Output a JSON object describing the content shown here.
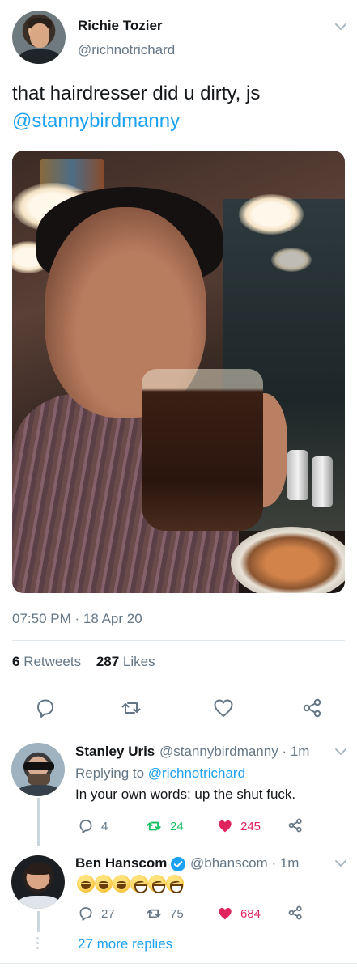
{
  "tweet": {
    "author_name": "Richie Tozier",
    "author_handle": "@richnotrichard",
    "text": "that hairdresser did u dirty, js",
    "mention": "@stannybirdmanny",
    "timestamp": "07:50 PM · 18 Apr 20",
    "retweets_count": "6",
    "retweets_label": "Retweets",
    "likes_count": "287",
    "likes_label": "Likes"
  },
  "actions": {
    "reply_icon": "reply-icon",
    "retweet_icon": "retweet-icon",
    "like_icon": "heart-icon",
    "share_icon": "share-icon"
  },
  "replies": [
    {
      "name": "Stanley Uris",
      "handle": "@stannybirdmanny",
      "time": "· 1m",
      "replying_prefix": "Replying to",
      "replying_to": "@richnotrichard",
      "text": "In your own words: up the shut fuck.",
      "reply_count": "4",
      "retweet_count": "24",
      "like_count": "245"
    },
    {
      "name": "Ben Hanscom",
      "handle": "@bhanscom",
      "time": "· 1m",
      "verified": true,
      "text": "😂😂😂🤣🤣🤣",
      "reply_count": "27",
      "retweet_count": "75",
      "like_count": "684"
    }
  ],
  "more_replies": "27 more replies",
  "colors": {
    "accent": "#1da1f2",
    "retweet_green": "#17bf63",
    "like_red": "#e0245e",
    "secondary_text": "#657786"
  }
}
